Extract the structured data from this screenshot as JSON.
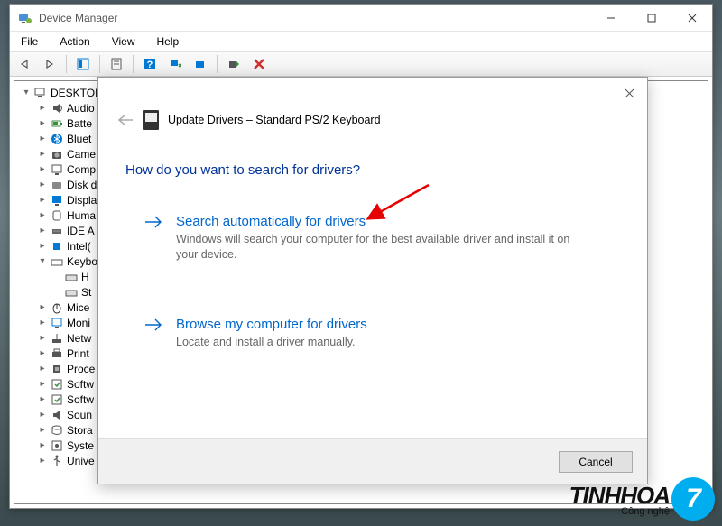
{
  "window": {
    "title": "Device Manager"
  },
  "menu": {
    "file": "File",
    "action": "Action",
    "view": "View",
    "help": "Help"
  },
  "tree": {
    "root": "DESKTOP",
    "items": [
      {
        "label": "Audio",
        "chev": "▸"
      },
      {
        "label": "Batte",
        "chev": "▸"
      },
      {
        "label": "Bluet",
        "chev": "▸"
      },
      {
        "label": "Came",
        "chev": "▸"
      },
      {
        "label": "Comp",
        "chev": "▸"
      },
      {
        "label": "Disk d",
        "chev": "▸"
      },
      {
        "label": "Displa",
        "chev": "▸"
      },
      {
        "label": "Huma",
        "chev": "▸"
      },
      {
        "label": "IDE A",
        "chev": "▸"
      },
      {
        "label": "Intel(",
        "chev": "▸"
      },
      {
        "label": "Keybo",
        "chev": "▾"
      },
      {
        "label": "Mice",
        "chev": "▸"
      },
      {
        "label": "Moni",
        "chev": "▸"
      },
      {
        "label": "Netw",
        "chev": "▸"
      },
      {
        "label": "Print",
        "chev": "▸"
      },
      {
        "label": "Proce",
        "chev": "▸"
      },
      {
        "label": "Softw",
        "chev": "▸"
      },
      {
        "label": "Softw",
        "chev": "▸"
      },
      {
        "label": "Soun",
        "chev": "▸"
      },
      {
        "label": "Stora",
        "chev": "▸"
      },
      {
        "label": "Syste",
        "chev": "▸"
      },
      {
        "label": "Unive",
        "chev": "▸"
      }
    ],
    "keyboard_children": [
      {
        "label": "H"
      },
      {
        "label": "St"
      }
    ]
  },
  "dialog": {
    "title": "Update Drivers – Standard PS/2 Keyboard",
    "prompt": "How do you want to search for drivers?",
    "option1": {
      "title": "Search automatically for drivers",
      "desc": "Windows will search your computer for the best available driver and install it on your device."
    },
    "option2": {
      "title": "Browse my computer for drivers",
      "desc": "Locate and install a driver manually."
    },
    "cancel": "Cancel"
  },
  "watermark": {
    "brand": "TINHHOA",
    "sub": "Công nghệ",
    "badge": "7"
  }
}
